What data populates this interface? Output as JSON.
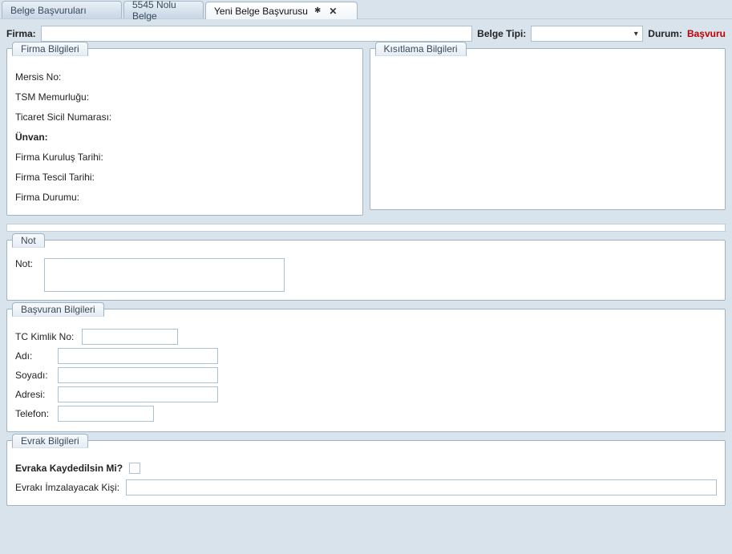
{
  "tabs": {
    "t0": "Belge Başvuruları",
    "t1": "5545 Nolu Belge",
    "t2": "Yeni Belge Başvurusu"
  },
  "toprow": {
    "firma_label": "Firma:",
    "firma_value": "",
    "belge_tipi_label": "Belge Tipi:",
    "belge_tipi_value": "",
    "durum_label": "Durum:",
    "durum_value": "Başvuru"
  },
  "fieldsets": {
    "firma_bilgileri": {
      "legend": "Firma Bilgileri",
      "mersis": "Mersis No:",
      "tsm": "TSM Memurluğu:",
      "ticaret_sicil": "Ticaret Sicil Numarası:",
      "unvan": "Ünvan:",
      "kurulus": "Firma Kuruluş Tarihi:",
      "tescil": "Firma Tescil Tarihi:",
      "durum": "Firma Durumu:"
    },
    "kisitlama": {
      "legend": "Kısıtlama Bilgileri"
    },
    "not": {
      "legend": "Not",
      "not_label": "Not:",
      "not_value": ""
    },
    "basvuran": {
      "legend": "Başvuran Bilgileri",
      "tc_label": "TC Kimlik No:",
      "tc_value": "",
      "adi_label": "Adı:",
      "adi_value": "",
      "soyadi_label": "Soyadı:",
      "soyadi_value": "",
      "adresi_label": "Adresi:",
      "adresi_value": "",
      "telefon_label": "Telefon:",
      "telefon_value": ""
    },
    "evrak": {
      "legend": "Evrak Bilgileri",
      "kaydedilsin_label": "Evraka Kaydedilsin Mi?",
      "imzalayacak_label": "Evrakı İmzalayacak Kişi:",
      "imzalayacak_value": ""
    }
  }
}
